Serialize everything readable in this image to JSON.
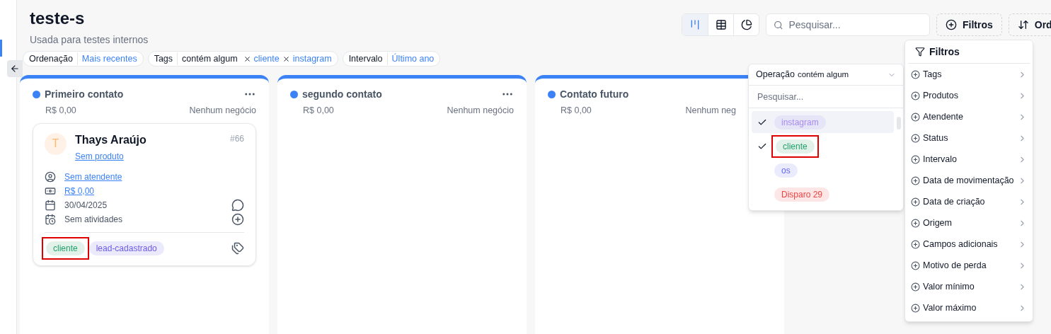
{
  "page": {
    "title": "teste-s",
    "subtitle": "Usada para testes internos"
  },
  "views": [
    {
      "kind": "kanban",
      "selected": true
    },
    {
      "kind": "table",
      "selected": false
    },
    {
      "kind": "chart",
      "selected": false
    }
  ],
  "search": {
    "placeholder": "Pesquisar..."
  },
  "buttons": [
    {
      "kind": "filter",
      "label": "Filtros"
    },
    {
      "kind": "sort",
      "label": "Ord"
    }
  ],
  "active_filters": [
    {
      "label": "Ordenação",
      "values": [
        {
          "text": "Mais recentes",
          "removable": false
        }
      ]
    },
    {
      "label": "Tags",
      "operator": "contém algum",
      "values": [
        {
          "text": "cliente",
          "removable": true
        },
        {
          "text": "instagram",
          "removable": true
        }
      ]
    },
    {
      "label": "Intervalo",
      "values": [
        {
          "text": "Último ano",
          "removable": false
        }
      ]
    }
  ],
  "columns": [
    {
      "title": "Primeiro contato",
      "color": "#3b82f6",
      "total": "R$ 0,00",
      "count": "Nenhum negócio",
      "cards": [
        {
          "initial": "T",
          "name": "Thays Araújo",
          "number": "#66",
          "product": "Sem produto",
          "fields": [
            {
              "kind": "agent",
              "text": "Sem atendente"
            },
            {
              "kind": "money",
              "text": "R$ 0,00"
            },
            {
              "kind": "date",
              "text": "30/04/2025"
            },
            {
              "kind": "activities",
              "text": "Sem atividades"
            }
          ],
          "tags": [
            {
              "text": "cliente",
              "color": "#22a06b",
              "annotated": true
            },
            {
              "text": "lead-cadastrado",
              "color": "#6b5ce7",
              "annotated": false
            }
          ]
        }
      ]
    },
    {
      "title": "segundo contato",
      "color": "#3b82f6",
      "total": "R$ 0,00",
      "count": "Nenhum negócio"
    },
    {
      "title": "Contato futuro",
      "color": "#3b82f6",
      "total": "R$ 0,00",
      "count": "Nenhum neg"
    }
  ],
  "tag_dropdown": {
    "operation_label": "Operação",
    "operation_value": "contém algum",
    "search_placeholder": "Pesquisar...",
    "options": [
      {
        "text": "instagram",
        "color": "#a88bf0",
        "checked": true,
        "hovered": true,
        "annotated": false
      },
      {
        "text": "cliente",
        "color": "#22a06b",
        "checked": true,
        "hovered": false,
        "annotated": true
      },
      {
        "text": "os",
        "color": "#6366f1",
        "checked": false,
        "hovered": false,
        "annotated": false
      },
      {
        "text": "Disparo 29",
        "color": "#ef4444",
        "checked": false,
        "hovered": false,
        "annotated": false
      }
    ]
  },
  "filter_menu": {
    "title": "Filtros",
    "items": [
      "Tags",
      "Produtos",
      "Atendente",
      "Status",
      "Intervalo",
      "Data de movimentação",
      "Data de criação",
      "Origem",
      "Campos adicionais",
      "Motivo de perda",
      "Valor mínimo",
      "Valor máximo"
    ]
  }
}
